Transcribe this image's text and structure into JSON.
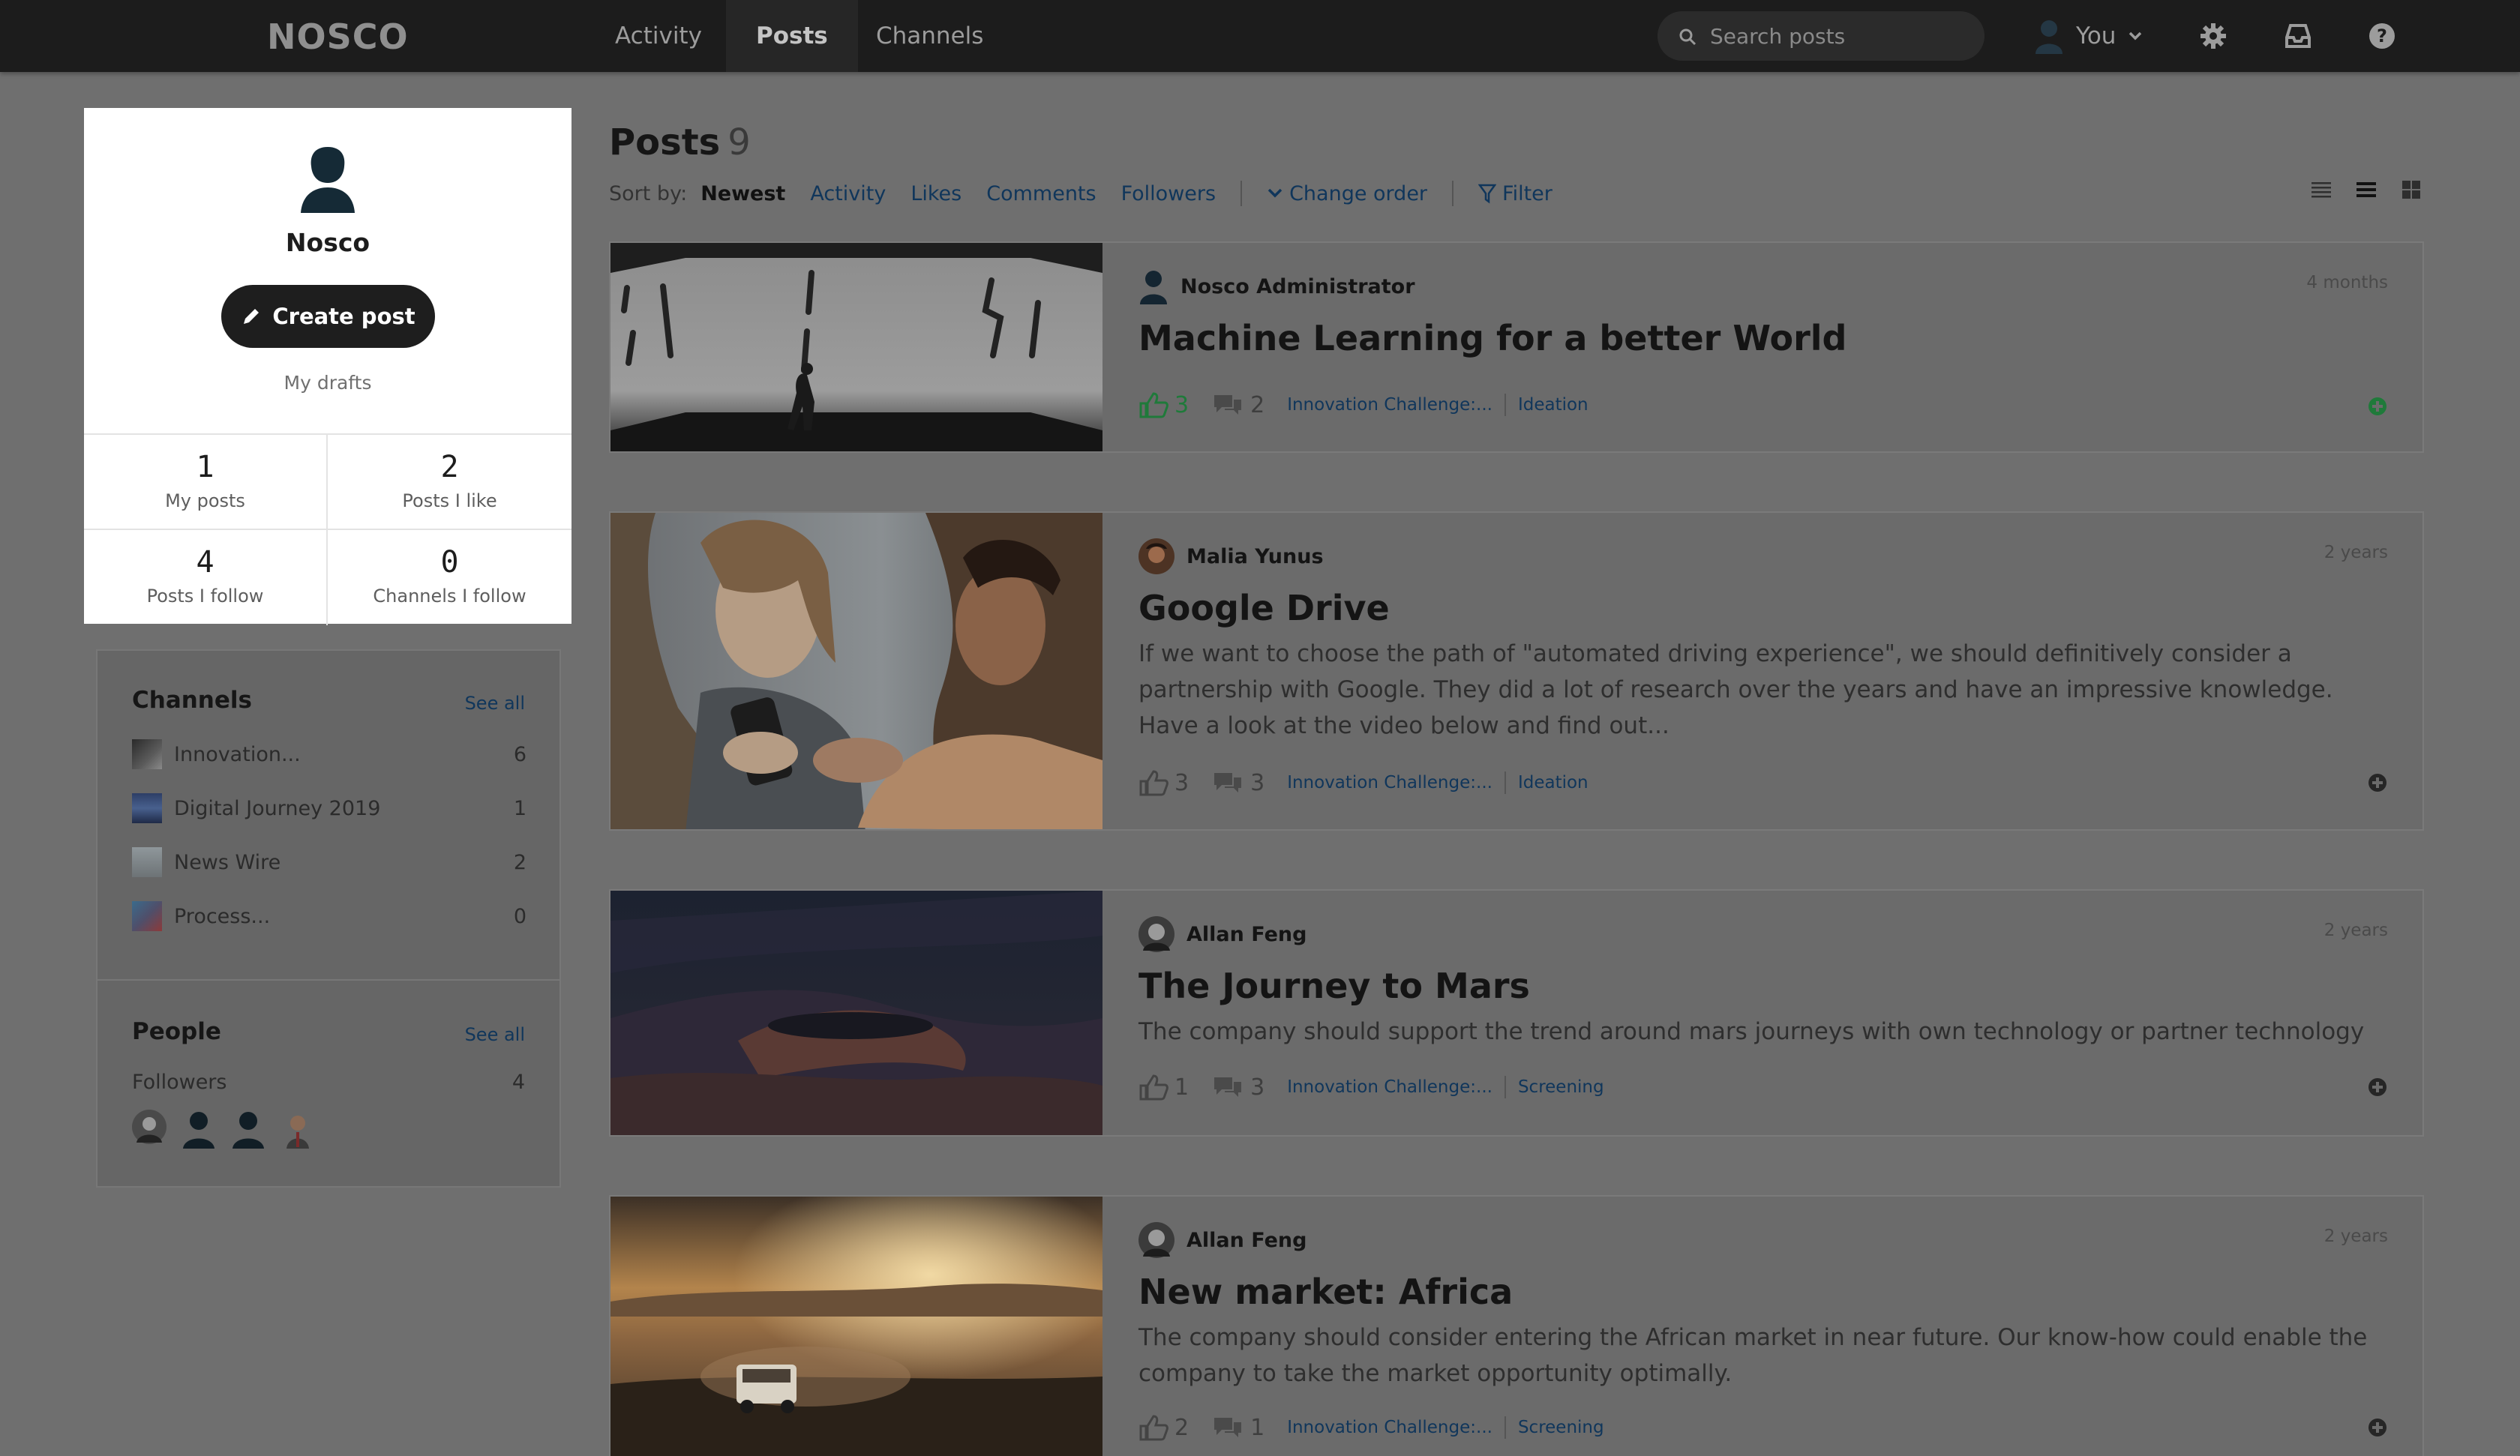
{
  "topbar": {
    "logo": "NOSCO",
    "nav": [
      "Activity",
      "Posts",
      "Channels"
    ],
    "search_placeholder": "Search posts",
    "user_label": "You",
    "icons": [
      "gear-icon",
      "inbox-icon",
      "help-icon"
    ]
  },
  "profile": {
    "name": "Nosco",
    "create_label": "Create post",
    "drafts_label": "My drafts",
    "stats": [
      {
        "num": "1",
        "label": "My posts"
      },
      {
        "num": "2",
        "label": "Posts I like"
      },
      {
        "num": "4",
        "label": "Posts I follow"
      },
      {
        "num": "0",
        "label": "Channels I follow"
      }
    ]
  },
  "channels": {
    "title": "Channels",
    "see_all": "See all",
    "items": [
      {
        "name": "Innovation...",
        "count": "6"
      },
      {
        "name": "Digital Journey 2019",
        "count": "1"
      },
      {
        "name": "News Wire",
        "count": "2"
      },
      {
        "name": "Process...",
        "count": "0"
      }
    ]
  },
  "people": {
    "title": "People",
    "see_all": "See all",
    "followers_label": "Followers",
    "followers_count": "4"
  },
  "main": {
    "title": "Posts",
    "count": "9",
    "sort_label": "Sort by:",
    "sort_options": [
      "Newest",
      "Activity",
      "Likes",
      "Comments",
      "Followers"
    ],
    "change_order": "Change order",
    "filter": "Filter"
  },
  "posts": [
    {
      "author": "Nosco Administrator",
      "age": "4 months",
      "title": "Machine Learning for a better World",
      "excerpt": "",
      "likes": "3",
      "comments": "2",
      "channel": "Innovation Challenge:...",
      "stage": "Ideation",
      "liked": true
    },
    {
      "author": "Malia Yunus",
      "age": "2 years",
      "title": "Google Drive",
      "excerpt": "If we want to choose the path of \"automated driving experience\", we should definitively consider a partnership with Google. They did a lot of research over the years and have an impressive knowledge. Have a look at the video below and find out...",
      "likes": "3",
      "comments": "3",
      "channel": "Innovation Challenge:...",
      "stage": "Ideation",
      "liked": false
    },
    {
      "author": "Allan Feng",
      "age": "2 years",
      "title": "The Journey to Mars",
      "excerpt": "The company should support the trend around mars journeys with own technology or partner technology",
      "likes": "1",
      "comments": "3",
      "channel": "Innovation Challenge:...",
      "stage": "Screening",
      "liked": false
    },
    {
      "author": "Allan Feng",
      "age": "2 years",
      "title": "New market: Africa",
      "excerpt": "The company should consider entering the African market in near future. Our know-how could enable the company to take the market opportunity optimally.",
      "likes": "2",
      "comments": "1",
      "channel": "Innovation Challenge:...",
      "stage": "Screening",
      "liked": false
    }
  ]
}
